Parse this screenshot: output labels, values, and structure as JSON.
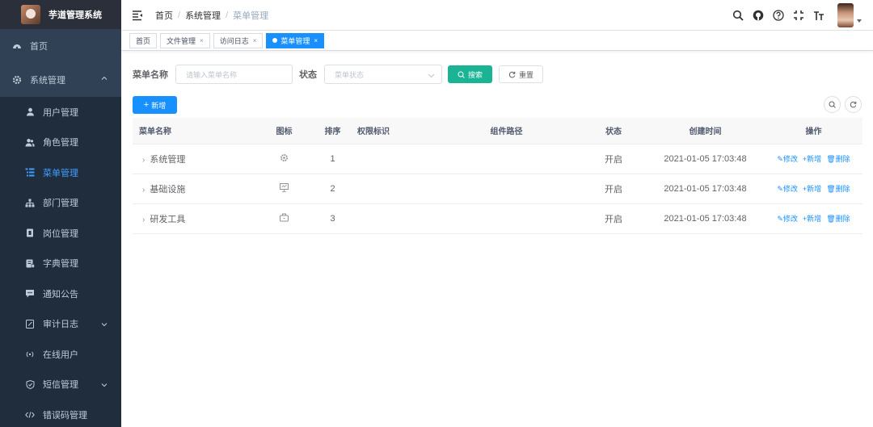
{
  "app": {
    "title": "芋道管理系统"
  },
  "sidebar": {
    "home": "首页",
    "system": "系统管理",
    "sub": [
      {
        "label": "用户管理",
        "icon": "user-icon"
      },
      {
        "label": "角色管理",
        "icon": "peoples-icon"
      },
      {
        "label": "菜单管理",
        "icon": "tree-table-icon",
        "active": true
      },
      {
        "label": "部门管理",
        "icon": "tree-icon"
      },
      {
        "label": "岗位管理",
        "icon": "post-icon"
      },
      {
        "label": "字典管理",
        "icon": "dict-icon"
      },
      {
        "label": "通知公告",
        "icon": "message-icon"
      },
      {
        "label": "审计日志",
        "icon": "log-icon",
        "has_arrow": true
      },
      {
        "label": "在线用户",
        "icon": "online-icon"
      },
      {
        "label": "短信管理",
        "icon": "validcode-icon",
        "has_arrow": true
      },
      {
        "label": "错误码管理",
        "icon": "code-icon"
      }
    ]
  },
  "breadcrumb": {
    "items": [
      "首页",
      "系统管理",
      "菜单管理"
    ]
  },
  "tags": [
    {
      "label": "首页",
      "closable": false
    },
    {
      "label": "文件管理",
      "closable": true
    },
    {
      "label": "访问日志",
      "closable": true
    },
    {
      "label": "菜单管理",
      "closable": true,
      "active": true
    }
  ],
  "search": {
    "menu_name_label": "菜单名称",
    "menu_name_placeholder": "请输入菜单名称",
    "status_label": "状态",
    "status_placeholder": "菜单状态",
    "search_button": "搜索",
    "reset_button": "重置"
  },
  "toolbar": {
    "add_button": "新增"
  },
  "table": {
    "headers": [
      "菜单名称",
      "图标",
      "排序",
      "权限标识",
      "组件路径",
      "状态",
      "创建时间",
      "操作"
    ],
    "rows": [
      {
        "name": "系统管理",
        "icon": "system-icon",
        "sort": "1",
        "perm": "",
        "component": "",
        "status": "开启",
        "created": "2021-01-05 17:03:48"
      },
      {
        "name": "基础设施",
        "icon": "monitor-icon",
        "sort": "2",
        "perm": "",
        "component": "",
        "status": "开启",
        "created": "2021-01-05 17:03:48"
      },
      {
        "name": "研发工具",
        "icon": "tool-icon",
        "sort": "3",
        "perm": "",
        "component": "",
        "status": "开启",
        "created": "2021-01-05 17:03:48"
      }
    ],
    "actions": {
      "edit": "修改",
      "add": "新增",
      "delete": "删除"
    }
  }
}
